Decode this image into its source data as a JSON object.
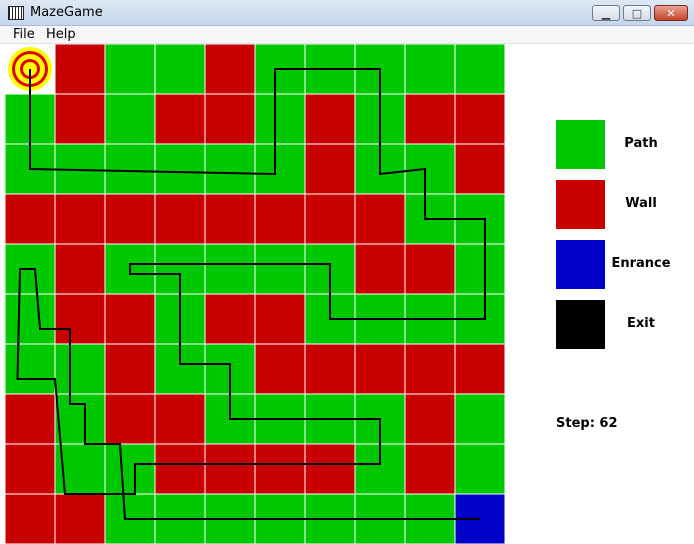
{
  "window": {
    "title": "MazeGame",
    "minimize_glyph": "▁",
    "maximize_glyph": "□",
    "close_glyph": "✕"
  },
  "menu": {
    "file_label": "File",
    "help_label": "Help"
  },
  "colors": {
    "path": "#00c800",
    "wall": "#c80000",
    "entrance": "#0000c8",
    "exit": "#000000",
    "grid_line": "#ffffff",
    "target_ring_outer": "#ffff00",
    "target_ring_inner": "#e00000",
    "route_line": "#000000"
  },
  "maze": {
    "rows": 10,
    "cols": 10,
    "cells": [
      "XWPPWPPPPP",
      "PWPWWPWPWW",
      "PPPPPPWPPW",
      "WWWWWWWWPP",
      "PWPPPPPWWP",
      "PWWPWWPPPP",
      "PPWPPWWWWW",
      "WPWWPPPPWP",
      "WPPWWWWPWP",
      "WWPPPPPPPE"
    ],
    "route": [
      [
        9.5,
        9.5
      ],
      [
        2.4,
        9.5
      ],
      [
        2.3,
        8.0
      ],
      [
        1.6,
        8.0
      ],
      [
        1.6,
        7.2
      ],
      [
        1.3,
        7.2
      ],
      [
        1.3,
        5.7
      ],
      [
        0.7,
        5.7
      ],
      [
        0.6,
        4.5
      ],
      [
        0.3,
        4.5
      ],
      [
        0.25,
        6.7
      ],
      [
        1.0,
        6.7
      ],
      [
        1.2,
        9.0
      ],
      [
        2.6,
        9.0
      ],
      [
        2.6,
        8.4
      ],
      [
        7.5,
        8.4
      ],
      [
        7.5,
        7.5
      ],
      [
        4.5,
        7.5
      ],
      [
        4.5,
        6.4
      ],
      [
        3.5,
        6.4
      ],
      [
        3.5,
        4.6
      ],
      [
        2.5,
        4.6
      ],
      [
        2.5,
        4.4
      ],
      [
        6.5,
        4.4
      ],
      [
        6.5,
        5.5
      ],
      [
        9.6,
        5.5
      ],
      [
        9.6,
        3.5
      ],
      [
        8.4,
        3.5
      ],
      [
        8.4,
        2.5
      ],
      [
        7.5,
        2.6
      ],
      [
        7.5,
        0.5
      ],
      [
        5.4,
        0.5
      ],
      [
        5.4,
        2.6
      ],
      [
        0.5,
        2.5
      ],
      [
        0.5,
        0.5
      ]
    ]
  },
  "legend": [
    {
      "label": "Path",
      "color_key": "path"
    },
    {
      "label": "Wall",
      "color_key": "wall"
    },
    {
      "label": "Enrance",
      "color_key": "entrance"
    },
    {
      "label": "Exit",
      "color_key": "exit"
    }
  ],
  "status": {
    "step_text": "Step: 62"
  }
}
